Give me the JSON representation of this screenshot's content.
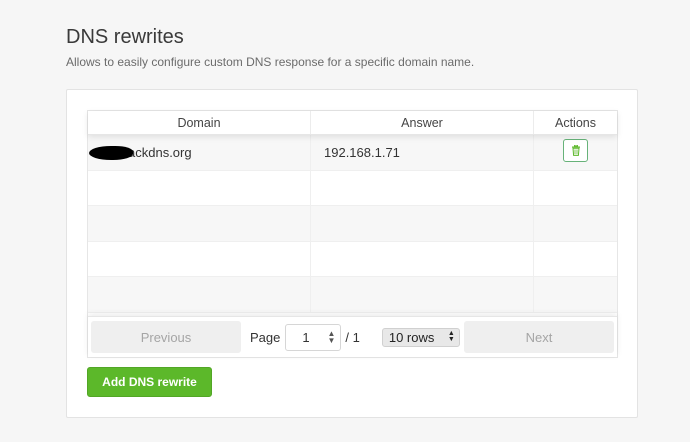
{
  "header": {
    "title": "DNS rewrites",
    "subtitle": "Allows to easily configure custom DNS response for a specific domain name."
  },
  "table": {
    "columns": [
      "Domain",
      "Answer",
      "Actions"
    ],
    "rows": [
      {
        "domain": "ackdns.org",
        "answer": "192.168.1.71",
        "action_icon": "trash-icon"
      }
    ]
  },
  "pagination": {
    "previous_label": "Previous",
    "page_label": "Page",
    "current_page": "1",
    "total_pages": "/ 1",
    "rows_per_page": "10 rows",
    "next_label": "Next"
  },
  "actions": {
    "add_label": "Add DNS rewrite"
  },
  "colors": {
    "accent_green": "#5cb82a",
    "delete_border": "#67b279"
  }
}
